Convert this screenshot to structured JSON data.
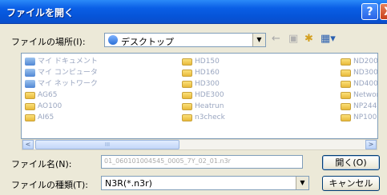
{
  "window": {
    "title": "ファイルを開く",
    "help_glyph": "?",
    "close_glyph": "X"
  },
  "lookin": {
    "label": "ファイルの場所(I):",
    "value": "デスクトップ",
    "dropdown_glyph": "▼"
  },
  "toolbar": {
    "back_glyph": "←",
    "up_glyph": "▣",
    "new_folder_glyph": "✱",
    "view_glyph": "▦▾"
  },
  "files": {
    "column1": [
      "マイ ドキュメント",
      "マイ コンピュータ",
      "マイ ネットワーク",
      "AG65",
      "AO100",
      "AI65"
    ],
    "column2": [
      "HD150",
      "HD160",
      "HD300",
      "HDE300",
      "Heatrun",
      "n3check"
    ],
    "column3": [
      "ND200",
      "ND300",
      "ND400",
      "Networ",
      "NP244",
      "NP100"
    ]
  },
  "scrollbar": {
    "left_glyph": "<",
    "right_glyph": ">",
    "thumb_grip": "III"
  },
  "filename": {
    "label": "ファイル名(N):",
    "value": "01_060101004545_0005_7Y_02_01.n3r"
  },
  "filetype": {
    "label": "ファイルの種類(T):",
    "value": "N3R(*.n3r)",
    "dropdown_glyph": "▼"
  },
  "buttons": {
    "open": "開く(O)",
    "cancel": "キャンセル"
  }
}
